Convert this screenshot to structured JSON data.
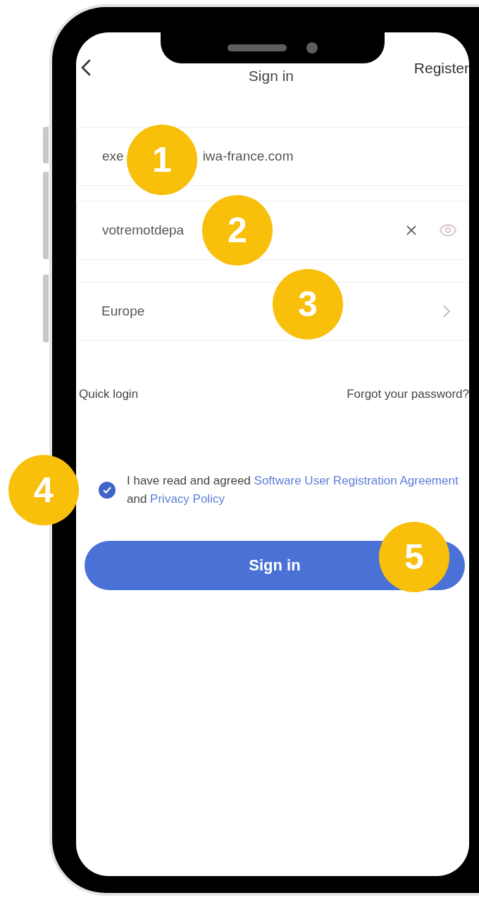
{
  "header": {
    "title": "Sign in",
    "action": "Register"
  },
  "email_field": {
    "value_start": "exe",
    "value_end": "iwa-france.com",
    "marker": "1"
  },
  "password_field": {
    "value": "votremotdepa",
    "marker": "2"
  },
  "region_field": {
    "value": "Europe",
    "marker": "3"
  },
  "links": {
    "quick_login": "Quick login",
    "forgot_password": "Forgot your password?"
  },
  "agreement": {
    "checked": true,
    "marker": "4",
    "text": "I have read and agreed",
    "link_1": "Software User Registration Agreement",
    "connector": "and",
    "link_2": "Privacy Policy"
  },
  "sign_in_button": {
    "label": "Sign in",
    "marker": "5"
  }
}
